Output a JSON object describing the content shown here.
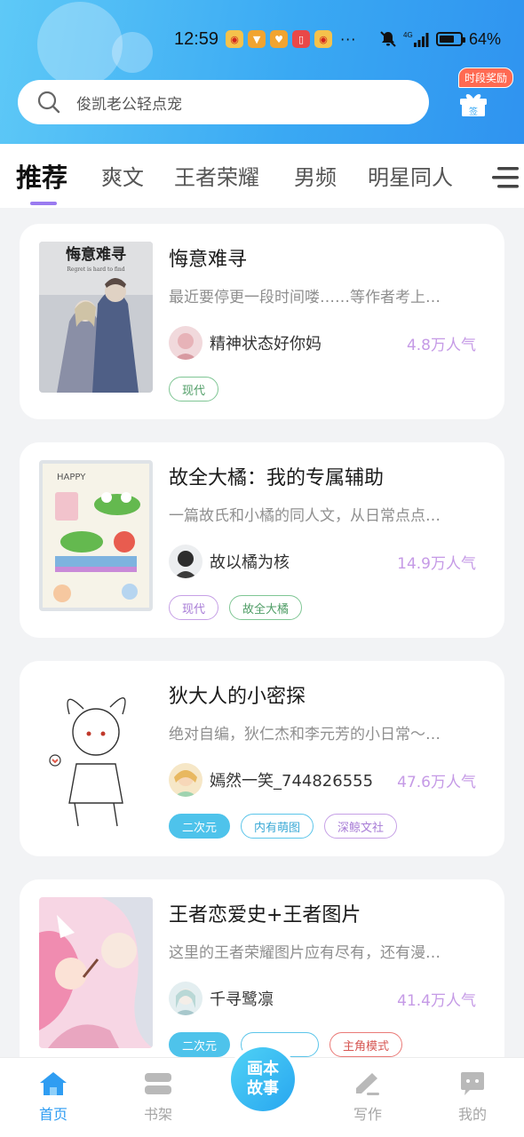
{
  "status_bar": {
    "time": "12:59",
    "more": "···",
    "network": "4G",
    "battery_percent": "64%"
  },
  "search": {
    "placeholder": "俊凯老公轻点宠",
    "icon": "search-icon"
  },
  "gift": {
    "badge": "时段奖励",
    "sign_label": "签",
    "icon": "gift-icon"
  },
  "tabs": [
    {
      "label": "推荐",
      "active": true
    },
    {
      "label": "爽文"
    },
    {
      "label": "王者荣耀"
    },
    {
      "label": "男频"
    },
    {
      "label": "明星同人"
    }
  ],
  "stories": [
    {
      "title": "悔意难寻",
      "description": "最近要停更一段时间喽……等作者考上…",
      "author": "精神状态好你妈",
      "popularity": "4.8万人气",
      "tags": [
        {
          "label": "现代",
          "style": "green"
        }
      ],
      "cover_text": "悔意难寻",
      "cover_subtext": "Regret is hard to find"
    },
    {
      "title": "故全大橘：我的专属辅助",
      "description": "一篇故氏和小橘的同人文，从日常点点…",
      "author": "故以橘为核",
      "popularity": "14.9万人气",
      "tags": [
        {
          "label": "现代",
          "style": "purple"
        },
        {
          "label": "故全大橘",
          "style": "green"
        }
      ],
      "cover_text": "HAPPY"
    },
    {
      "title": "狄大人的小密探",
      "description": "绝对自编，狄仁杰和李元芳的小日常～…",
      "author": "嫣然一笑_744826555",
      "popularity": "47.6万人气",
      "tags": [
        {
          "label": "二次元",
          "style": "cyan-fill"
        },
        {
          "label": "内有萌图",
          "style": "cyan"
        },
        {
          "label": "深鲸文社",
          "style": "purple"
        }
      ]
    },
    {
      "title": "王者恋爱史+王者图片",
      "description": "这里的王者荣耀图片应有尽有，还有漫…",
      "author": "千寻鹭凛",
      "popularity": "41.4万人气",
      "tags": [
        {
          "label": "二次元",
          "style": "cyan-fill"
        },
        {
          "label": "",
          "style": "cyan"
        },
        {
          "label": "主角模式",
          "style": "red"
        }
      ]
    }
  ],
  "bottom_nav": {
    "home": "首页",
    "bookshelf": "书架",
    "center_line1": "画本",
    "center_line2": "故事",
    "write": "写作",
    "mine": "我的"
  },
  "colors": {
    "accent_blue": "#2f9df2",
    "tab_underline": "#9a7bf0",
    "popularity": "#c59ae6"
  }
}
